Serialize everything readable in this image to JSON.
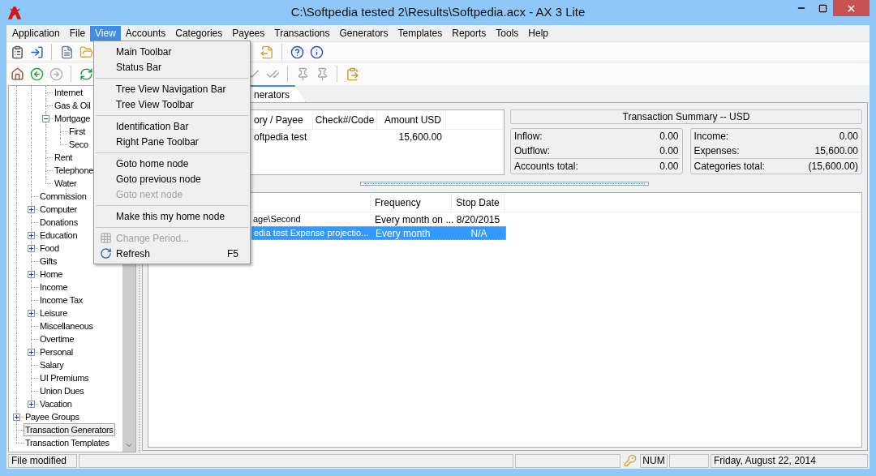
{
  "window": {
    "title": "C:\\Softpedia tested 2\\Results\\Softpedia.acx - AX 3 Lite"
  },
  "menu_bar": [
    {
      "label": "Application",
      "selected": false
    },
    {
      "label": "File",
      "selected": false
    },
    {
      "label": "View",
      "selected": true
    },
    {
      "label": "Accounts",
      "selected": false
    },
    {
      "label": "Categories",
      "selected": false
    },
    {
      "label": "Payees",
      "selected": false
    },
    {
      "label": "Transactions",
      "selected": false
    },
    {
      "label": "Generators",
      "selected": false
    },
    {
      "label": "Templates",
      "selected": false
    },
    {
      "label": "Reports",
      "selected": false
    },
    {
      "label": "Tools",
      "selected": false
    },
    {
      "label": "Help",
      "selected": false
    }
  ],
  "view_menu": {
    "items": [
      {
        "kind": "item",
        "label": "Main Toolbar",
        "disabled": false
      },
      {
        "kind": "item",
        "label": "Status Bar",
        "disabled": false
      },
      {
        "kind": "separator"
      },
      {
        "kind": "item",
        "label": "Tree View Navigation Bar",
        "disabled": false
      },
      {
        "kind": "item",
        "label": "Tree View Toolbar",
        "disabled": false
      },
      {
        "kind": "separator"
      },
      {
        "kind": "item",
        "label": "Identification Bar",
        "disabled": false
      },
      {
        "kind": "item",
        "label": "Right Pane Toolbar",
        "disabled": false
      },
      {
        "kind": "separator"
      },
      {
        "kind": "item",
        "label": "Goto home node",
        "disabled": false
      },
      {
        "kind": "item",
        "label": "Goto previous node",
        "disabled": false
      },
      {
        "kind": "item",
        "label": "Goto next node",
        "disabled": true
      },
      {
        "kind": "separator"
      },
      {
        "kind": "item",
        "label": "Make this my home node",
        "disabled": false
      },
      {
        "kind": "separator"
      },
      {
        "kind": "item",
        "label": "Change Period...",
        "disabled": true
      },
      {
        "kind": "item",
        "label": "Refresh",
        "disabled": false,
        "shortcut": "F5"
      }
    ]
  },
  "tree": {
    "items": [
      {
        "children": [
          {
            "children": [
              {
                "label": "Internet",
                "selected": false
              },
              {
                "label": "Gas & Oil",
                "selected": false
              },
              {
                "label": "Mortgage",
                "selected": false,
                "expanded": true,
                "children": [
                  {
                    "label": "First",
                    "selected": false
                  },
                  {
                    "label": "Seco",
                    "selected": false
                  }
                ]
              },
              {
                "label": "Rent",
                "selected": false
              },
              {
                "label": "Telephone",
                "selected": false
              },
              {
                "label": "Water",
                "selected": false
              }
            ]
          },
          {
            "label": "Commission",
            "selected": false
          },
          {
            "label": "Computer",
            "selected": false,
            "expanded": false
          },
          {
            "label": "Donations",
            "selected": false
          },
          {
            "label": "Education",
            "selected": false,
            "expanded": false
          },
          {
            "label": "Food",
            "selected": false,
            "expanded": false
          },
          {
            "label": "Gifts",
            "selected": false
          },
          {
            "label": "Home",
            "selected": false,
            "expanded": false
          },
          {
            "label": "Income",
            "selected": false
          },
          {
            "label": "Income Tax",
            "selected": false
          },
          {
            "label": "Leisure",
            "selected": false,
            "expanded": false
          },
          {
            "label": "Miscellaneous",
            "selected": false
          },
          {
            "label": "Overtime",
            "selected": false
          },
          {
            "label": "Personal",
            "selected": false,
            "expanded": false
          },
          {
            "label": "Salary",
            "selected": false
          },
          {
            "label": "UI Premiums",
            "selected": false
          },
          {
            "label": "Union Dues",
            "selected": false
          },
          {
            "label": "Vacation",
            "selected": false,
            "expanded": false
          }
        ]
      },
      {
        "label": "Payee Groups",
        "selected": false,
        "expanded": false
      },
      {
        "label": "Transaction Generators",
        "selected": true
      },
      {
        "label": "Transaction Templates",
        "selected": false
      }
    ]
  },
  "tab": {
    "label": "nerators",
    "selected": true
  },
  "upper_table": {
    "columns": [
      "ory / Payee",
      "Check#/Code",
      "Amount USD"
    ],
    "rows": [
      {
        "column_1": "oftpedia test",
        "amount_usd": "15,600.00"
      }
    ]
  },
  "summary": {
    "title": "Transaction Summary -- USD",
    "accounts": [
      {
        "label": "Inflow:",
        "value": "0.00"
      },
      {
        "label": "Outflow:",
        "value": "0.00"
      }
    ],
    "accounts_total": {
      "label": "Accounts total:",
      "value": "0.00"
    },
    "categories": [
      {
        "label": "Income:",
        "value": "0.00"
      },
      {
        "label": "Expenses:",
        "value": "15,600.00"
      }
    ],
    "categories_total": {
      "label": "Categories total:",
      "value": "(15,600.00)"
    }
  },
  "lower_table": {
    "columns": [
      "Frequency",
      "Stop Date"
    ],
    "rows": [
      {
        "column_1": "age\\Second",
        "frequency": "Every month on ...",
        "stop_date": "8/20/2015",
        "selected": false
      },
      {
        "column_1": "edia test Expense projectio...",
        "frequency": "Every month",
        "stop_date": "N/A",
        "selected": true
      }
    ]
  },
  "status_bar": {
    "message": "File modified",
    "num": "NUM",
    "date": "Friday, August 22, 2014"
  }
}
